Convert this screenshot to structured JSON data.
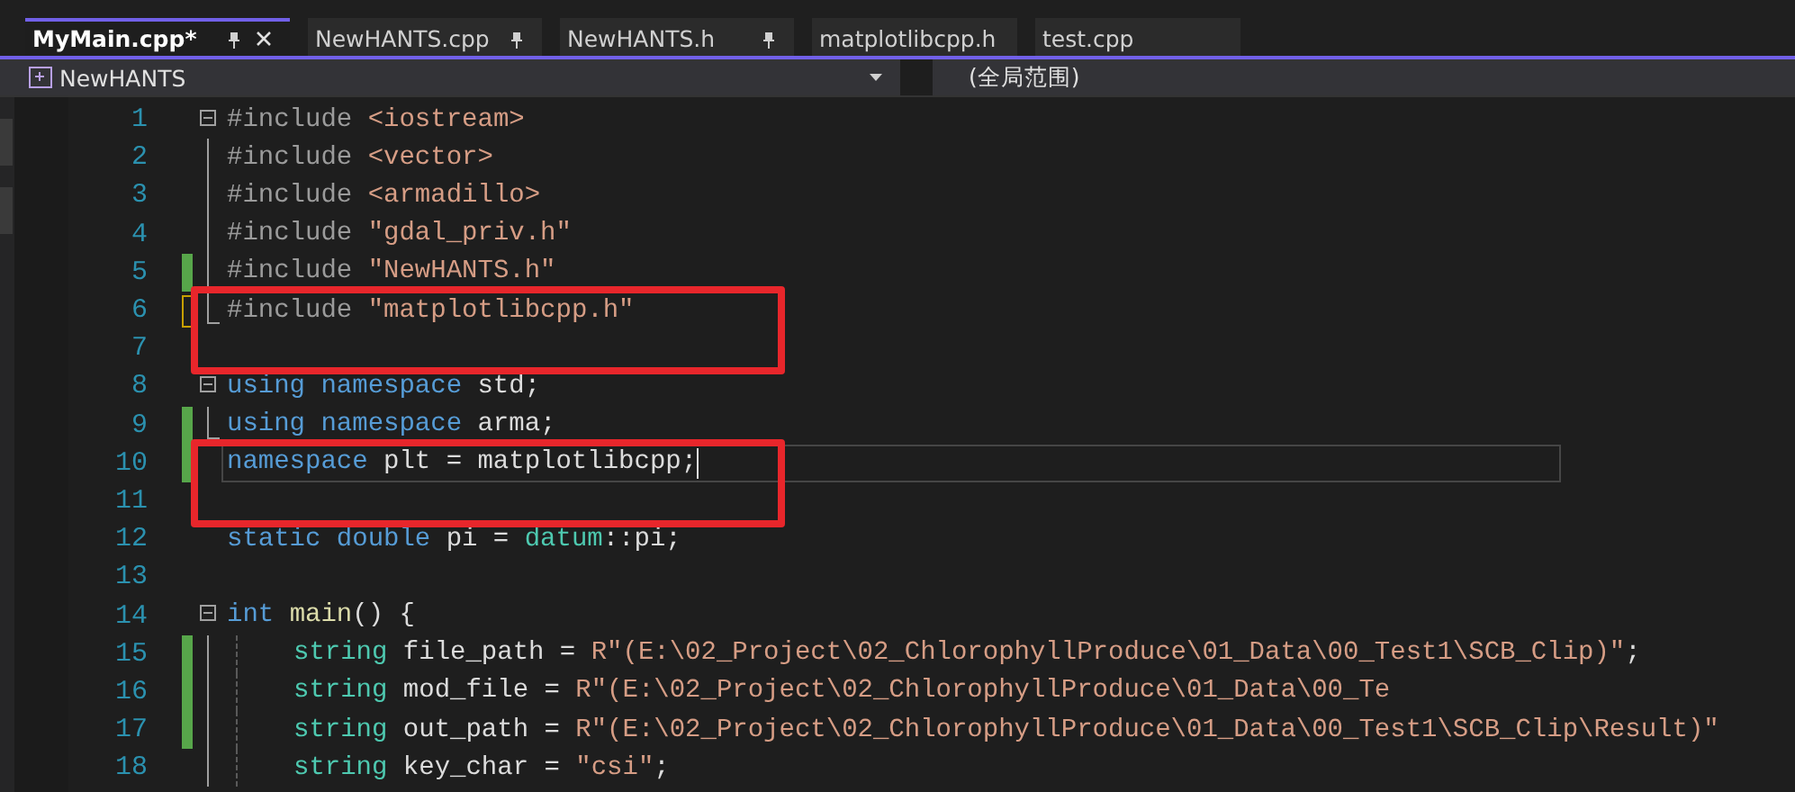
{
  "tabs": [
    {
      "label": "MyMain.cpp*",
      "selected": true,
      "pinned": true
    },
    {
      "label": "NewHANTS.cpp",
      "selected": false,
      "pinned": true
    },
    {
      "label": "NewHANTS.h",
      "selected": false,
      "pinned": true
    },
    {
      "label": "matplotlibcpp.h",
      "selected": false,
      "pinned": false
    },
    {
      "label": "test.cpp",
      "selected": false,
      "pinned": false
    }
  ],
  "nav_bar": {
    "project": "NewHANTS",
    "scope": "(全局范围)"
  },
  "lines": [
    {
      "number": "1",
      "fold": {
        "kind": "start"
      },
      "tokens": [
        {
          "kind": "pre",
          "text": "#include "
        },
        {
          "kind": "str",
          "text": "<iostream>"
        }
      ]
    },
    {
      "number": "2",
      "fold": {
        "kind": "inside"
      },
      "tokens": [
        {
          "kind": "pre",
          "text": "#include "
        },
        {
          "kind": "str",
          "text": "<vector>"
        }
      ]
    },
    {
      "number": "3",
      "fold": {
        "kind": "inside"
      },
      "tokens": [
        {
          "kind": "pre",
          "text": "#include "
        },
        {
          "kind": "str",
          "text": "<armadillo>"
        }
      ]
    },
    {
      "number": "4",
      "fold": {
        "kind": "inside"
      },
      "tokens": [
        {
          "kind": "pre",
          "text": "#include "
        },
        {
          "kind": "str",
          "text": "\"gdal_priv.h\""
        }
      ]
    },
    {
      "number": "5",
      "fold": {
        "kind": "inside"
      },
      "change": {
        "kind": "saved"
      },
      "tokens": [
        {
          "kind": "pre",
          "text": "#include "
        },
        {
          "kind": "str",
          "text": "\"NewHANTS.h\""
        }
      ]
    },
    {
      "number": "6",
      "fold": {
        "kind": "end"
      },
      "change": {
        "kind": "unsaved"
      },
      "boxed": true,
      "tokens": [
        {
          "kind": "pre",
          "text": "#include "
        },
        {
          "kind": "str",
          "text": "\"matplotlibcpp.h\""
        }
      ]
    },
    {
      "number": "7",
      "boxed": true
    },
    {
      "number": "8",
      "fold": {
        "kind": "start"
      },
      "tokens": [
        {
          "kind": "kw",
          "text": "using namespace "
        },
        {
          "kind": "plain",
          "text": "std;"
        }
      ]
    },
    {
      "number": "9",
      "fold": {
        "kind": "end"
      },
      "change": {
        "kind": "saved"
      },
      "tokens": [
        {
          "kind": "kw",
          "text": "using namespace "
        },
        {
          "kind": "plain",
          "text": "arma;"
        }
      ]
    },
    {
      "number": "10",
      "change": {
        "kind": "saved"
      },
      "current": true,
      "boxed": true,
      "tokens": [
        {
          "kind": "kw",
          "text": "namespace "
        },
        {
          "kind": "plain",
          "text": "plt = matplotlibcpp;"
        }
      ]
    },
    {
      "number": "11",
      "boxed": true
    },
    {
      "number": "12",
      "tokens": [
        {
          "kind": "kw",
          "text": "static double "
        },
        {
          "kind": "plain",
          "text": "pi = "
        },
        {
          "kind": "type",
          "text": "datum"
        },
        {
          "kind": "plain",
          "text": "::pi;"
        }
      ]
    },
    {
      "number": "13"
    },
    {
      "number": "14",
      "fold": {
        "kind": "start"
      },
      "tokens": [
        {
          "kind": "kw",
          "text": "int "
        },
        {
          "kind": "fn",
          "text": "main"
        },
        {
          "kind": "plain",
          "text": "() {"
        }
      ]
    },
    {
      "number": "15",
      "fold": {
        "kind": "body"
      },
      "change": {
        "kind": "saved"
      },
      "tokens": [
        {
          "kind": "type",
          "text": "string "
        },
        {
          "kind": "plain",
          "text": "file_path = "
        },
        {
          "kind": "str",
          "text": "R\"(E:\\02_Project\\02_ChlorophyllProduce\\01_Data\\00_Test1\\SCB_Clip)\""
        },
        {
          "kind": "plain",
          "text": ";"
        }
      ]
    },
    {
      "number": "16",
      "fold": {
        "kind": "body"
      },
      "change": {
        "kind": "saved"
      },
      "tokens": [
        {
          "kind": "type",
          "text": "string "
        },
        {
          "kind": "plain",
          "text": "mod_file = "
        },
        {
          "kind": "str",
          "text": "R\"(E:\\02_Project\\02_ChlorophyllProduce\\01_Data\\00_Te"
        }
      ]
    },
    {
      "number": "17",
      "fold": {
        "kind": "body"
      },
      "change": {
        "kind": "saved"
      },
      "tokens": [
        {
          "kind": "type",
          "text": "string "
        },
        {
          "kind": "plain",
          "text": "out_path = "
        },
        {
          "kind": "str",
          "text": "R\"(E:\\02_Project\\02_ChlorophyllProduce\\01_Data\\00_Test1\\SCB_Clip\\Result)\""
        }
      ]
    },
    {
      "number": "18",
      "fold": {
        "kind": "body"
      },
      "tokens": [
        {
          "kind": "type",
          "text": "string "
        },
        {
          "kind": "plain",
          "text": "key_char = "
        },
        {
          "kind": "str",
          "text": "\"csi\""
        },
        {
          "kind": "plain",
          "text": ";"
        }
      ]
    }
  ]
}
